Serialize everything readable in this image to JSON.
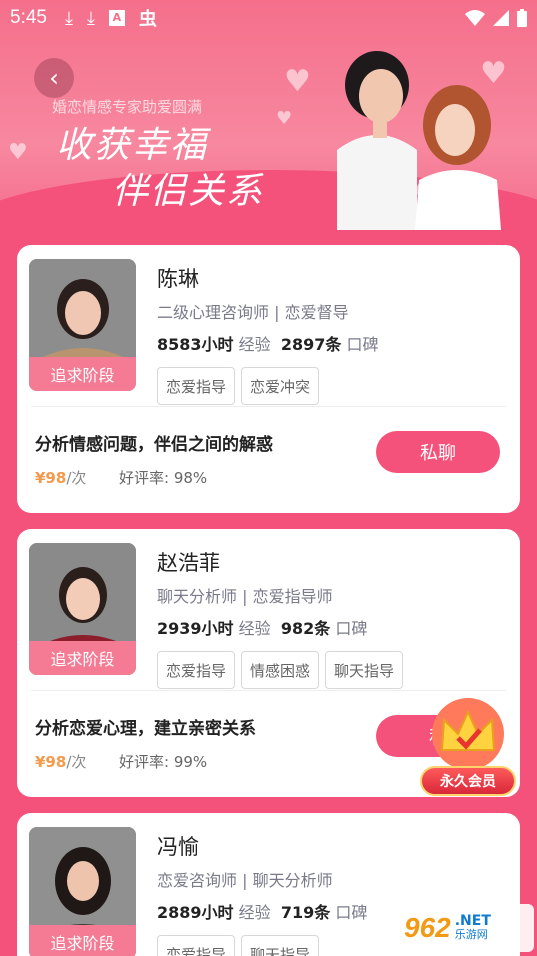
{
  "status_bar": {
    "time": "5:45"
  },
  "banner": {
    "subtitle": "婚恋情感专家助爱圆满",
    "line1": "收获幸福",
    "line2": "伴侣关系"
  },
  "counselors": [
    {
      "name": "陈琳",
      "title": "二级心理咨询师 | 恋爱督导",
      "hours": "8583小时",
      "exp_label": "经验",
      "reviews": "2897条",
      "reviews_label": "口碑",
      "tags": [
        "恋爱指导",
        "恋爱冲突"
      ],
      "stage": "追求阶段",
      "desc": "分析情感问题，伴侣之间的解惑",
      "price": "¥98",
      "price_unit": "/次",
      "rating_label": "好评率:",
      "rating": "98%",
      "chat": "私聊"
    },
    {
      "name": "赵浩菲",
      "title": "聊天分析师 | 恋爱指导师",
      "hours": "2939小时",
      "exp_label": "经验",
      "reviews": "982条",
      "reviews_label": "口碑",
      "tags": [
        "恋爱指导",
        "情感困惑",
        "聊天指导"
      ],
      "stage": "追求阶段",
      "desc": "分析恋爱心理，建立亲密关系",
      "price": "¥98",
      "price_unit": "/次",
      "rating_label": "好评率:",
      "rating": "99%",
      "chat": "私"
    },
    {
      "name": "冯愉",
      "title": "恋爱咨询师 | 聊天分析师",
      "hours": "2889小时",
      "exp_label": "经验",
      "reviews": "719条",
      "reviews_label": "口碑",
      "tags": [
        "恋爱指导",
        "聊天指导"
      ],
      "stage": "追求阶段"
    }
  ],
  "vip": {
    "label": "永久会员"
  },
  "watermark": {
    "number": "962",
    "net": ".NET",
    "site": "乐游网"
  }
}
